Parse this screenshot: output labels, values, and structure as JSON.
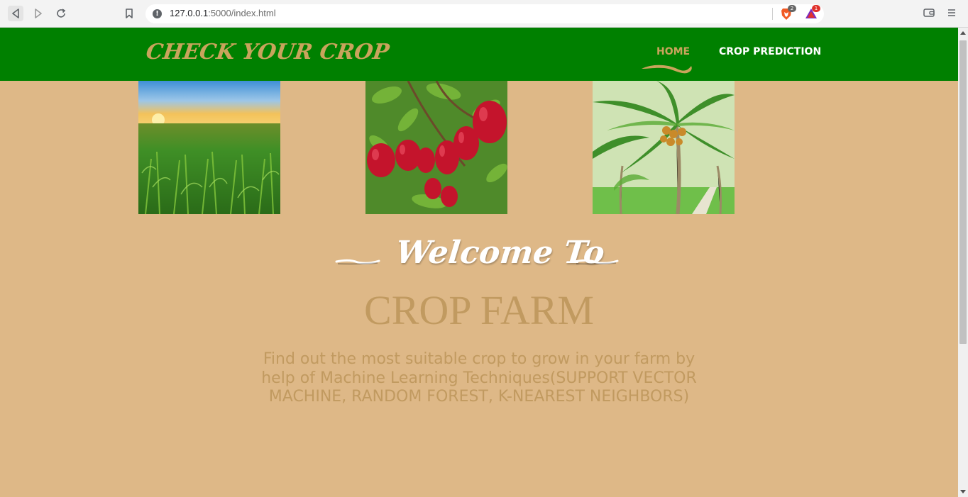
{
  "browser": {
    "url_domain": "127.0.0.1",
    "url_path": ":5000/index.html",
    "shields_badge": "2",
    "rewards_badge": "1",
    "icons": [
      "back-icon",
      "forward-icon",
      "reload-icon",
      "bookmark-icon",
      "info-icon",
      "brave-shields-icon",
      "brave-rewards-icon",
      "wallet-icon",
      "menu-icon"
    ]
  },
  "header": {
    "logo": "CHECK YOUR CROP",
    "nav": [
      {
        "label": "HOME",
        "active": true
      },
      {
        "label": "CROP PREDICTION",
        "active": false
      }
    ],
    "colors": {
      "background": "#008000",
      "accent": "#c9a45c",
      "text": "#ffffff"
    }
  },
  "gallery": [
    {
      "name": "corn-field-image"
    },
    {
      "name": "apple-tree-image"
    },
    {
      "name": "coconut-tree-image"
    }
  ],
  "hero": {
    "welcome": "Welcome To",
    "title": "CROP FARM",
    "description": "Find out the most suitable crop to grow in your farm by help of Machine Learning Techniques(SUPPORT VECTOR MACHINE, RANDOM FOREST, K-NEAREST NEIGHBORS)",
    "colors": {
      "background": "#deb887",
      "title": "#c19a60",
      "welcome": "#ffffff"
    }
  }
}
